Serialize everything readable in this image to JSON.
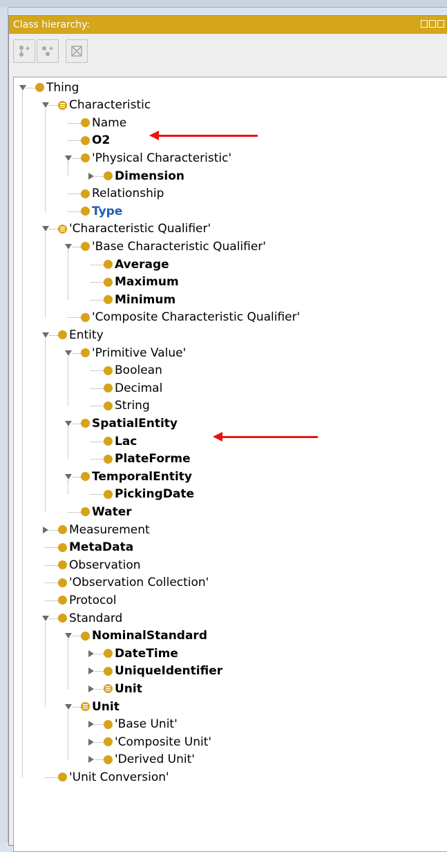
{
  "panel": {
    "title": "Class hierarchy:"
  },
  "toolbar": {
    "buttons": [
      {
        "name": "add-subclass-button",
        "icon": "add-subclass-icon"
      },
      {
        "name": "add-sibling-button",
        "icon": "add-sibling-icon"
      },
      {
        "name": "delete-class-button",
        "icon": "delete-class-icon"
      }
    ]
  },
  "tree": [
    {
      "label": "Thing",
      "depth": 0,
      "toggle": "expanded",
      "icon": "class"
    },
    {
      "label": "Characteristic",
      "depth": 1,
      "toggle": "expanded",
      "icon": "defined"
    },
    {
      "label": "Name",
      "depth": 2,
      "toggle": "leaf",
      "icon": "class"
    },
    {
      "label": "O2",
      "depth": 2,
      "toggle": "leaf",
      "icon": "class",
      "style": "bold"
    },
    {
      "label": "'Physical Characteristic'",
      "depth": 2,
      "toggle": "expanded",
      "icon": "class"
    },
    {
      "label": "Dimension",
      "depth": 3,
      "toggle": "collapsed",
      "icon": "class",
      "style": "bold"
    },
    {
      "label": "Relationship",
      "depth": 2,
      "toggle": "leaf",
      "icon": "class"
    },
    {
      "label": "Type",
      "depth": 2,
      "toggle": "leaf",
      "icon": "class",
      "style": "bold-blue"
    },
    {
      "label": "'Characteristic Qualifier'",
      "depth": 1,
      "toggle": "expanded",
      "icon": "defined"
    },
    {
      "label": "'Base Characteristic Qualifier'",
      "depth": 2,
      "toggle": "expanded",
      "icon": "class"
    },
    {
      "label": "Average",
      "depth": 3,
      "toggle": "leaf",
      "icon": "class",
      "style": "bold"
    },
    {
      "label": "Maximum",
      "depth": 3,
      "toggle": "leaf",
      "icon": "class",
      "style": "bold"
    },
    {
      "label": "Minimum",
      "depth": 3,
      "toggle": "leaf",
      "icon": "class",
      "style": "bold"
    },
    {
      "label": "'Composite Characteristic Qualifier'",
      "depth": 2,
      "toggle": "leaf",
      "icon": "class"
    },
    {
      "label": "Entity",
      "depth": 1,
      "toggle": "expanded",
      "icon": "class"
    },
    {
      "label": "'Primitive Value'",
      "depth": 2,
      "toggle": "expanded",
      "icon": "class"
    },
    {
      "label": "Boolean",
      "depth": 3,
      "toggle": "leaf",
      "icon": "class"
    },
    {
      "label": "Decimal",
      "depth": 3,
      "toggle": "leaf",
      "icon": "class"
    },
    {
      "label": "String",
      "depth": 3,
      "toggle": "leaf",
      "icon": "class"
    },
    {
      "label": "SpatialEntity",
      "depth": 2,
      "toggle": "expanded",
      "icon": "class",
      "style": "bold"
    },
    {
      "label": "Lac",
      "depth": 3,
      "toggle": "leaf",
      "icon": "class",
      "style": "bold"
    },
    {
      "label": "PlateForme",
      "depth": 3,
      "toggle": "leaf",
      "icon": "class",
      "style": "bold"
    },
    {
      "label": "TemporalEntity",
      "depth": 2,
      "toggle": "expanded",
      "icon": "class",
      "style": "bold"
    },
    {
      "label": "PickingDate",
      "depth": 3,
      "toggle": "leaf",
      "icon": "class",
      "style": "bold"
    },
    {
      "label": "Water",
      "depth": 2,
      "toggle": "leaf",
      "icon": "class",
      "style": "bold"
    },
    {
      "label": "Measurement",
      "depth": 1,
      "toggle": "collapsed",
      "icon": "class"
    },
    {
      "label": "MetaData",
      "depth": 1,
      "toggle": "leaf",
      "icon": "class",
      "style": "bold"
    },
    {
      "label": "Observation",
      "depth": 1,
      "toggle": "leaf",
      "icon": "class"
    },
    {
      "label": "'Observation Collection'",
      "depth": 1,
      "toggle": "leaf",
      "icon": "class"
    },
    {
      "label": "Protocol",
      "depth": 1,
      "toggle": "leaf",
      "icon": "class"
    },
    {
      "label": "Standard",
      "depth": 1,
      "toggle": "expanded",
      "icon": "class"
    },
    {
      "label": "NominalStandard",
      "depth": 2,
      "toggle": "expanded",
      "icon": "class",
      "style": "bold"
    },
    {
      "label": "DateTime",
      "depth": 3,
      "toggle": "collapsed",
      "icon": "class",
      "style": "bold"
    },
    {
      "label": "UniqueIdentifier",
      "depth": 3,
      "toggle": "collapsed",
      "icon": "class",
      "style": "bold"
    },
    {
      "label": "Unit",
      "depth": 3,
      "toggle": "collapsed",
      "icon": "defined",
      "style": "bold"
    },
    {
      "label": "Unit",
      "depth": 2,
      "toggle": "expanded",
      "icon": "defined",
      "style": "bold"
    },
    {
      "label": "'Base Unit'",
      "depth": 3,
      "toggle": "collapsed",
      "icon": "class"
    },
    {
      "label": "'Composite Unit'",
      "depth": 3,
      "toggle": "collapsed",
      "icon": "class"
    },
    {
      "label": "'Derived Unit'",
      "depth": 3,
      "toggle": "collapsed",
      "icon": "class"
    },
    {
      "label": "'Unit Conversion'",
      "depth": 1,
      "toggle": "leaf",
      "icon": "class"
    }
  ],
  "annotations": [
    {
      "points_to": "O2",
      "color": "#e8140e"
    },
    {
      "points_to": "Lac",
      "color": "#e8140e"
    }
  ],
  "colors": {
    "header": "#d5a51c",
    "class_icon": "#d8a218",
    "highlight_text": "#1f5fb4",
    "arrow": "#e8140e"
  }
}
